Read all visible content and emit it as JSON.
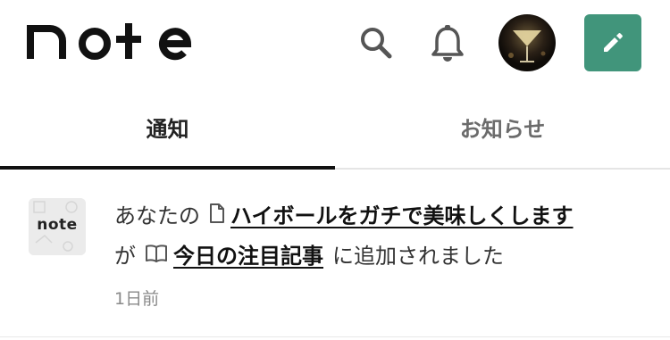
{
  "header": {
    "logo_text": "note",
    "icons": {
      "search": "search-icon",
      "bell": "bell-icon",
      "avatar": "user-avatar",
      "post": "pencil-icon"
    },
    "post_button_color": "#41957b"
  },
  "tabs": [
    {
      "label": "通知",
      "active": true
    },
    {
      "label": "お知らせ",
      "active": false
    }
  ],
  "notifications": [
    {
      "thumb_text": "note",
      "prefix": "あなたの",
      "article_title": "ハイボールをガチで美味しくします",
      "connector": "が",
      "magazine_title": "今日の注目記事",
      "suffix": "に追加されました",
      "time": "1日前"
    }
  ]
}
